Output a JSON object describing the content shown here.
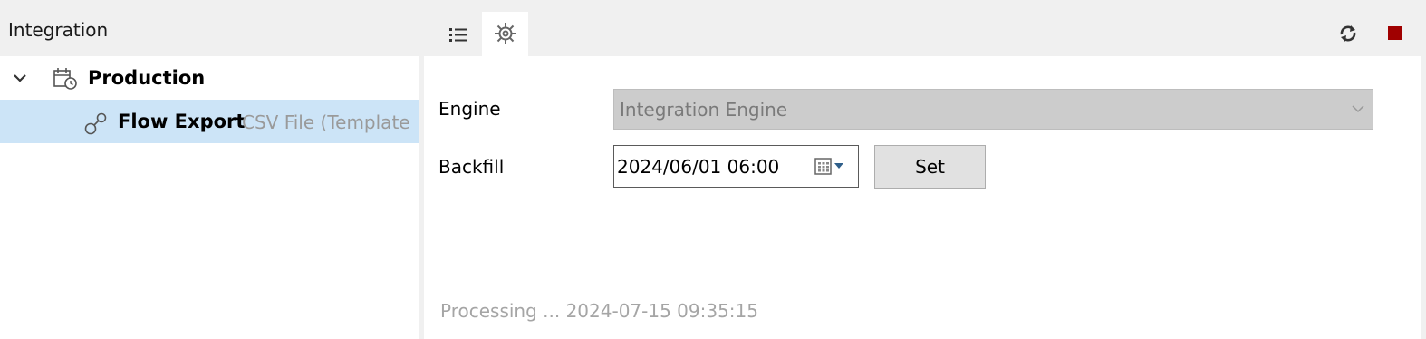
{
  "left_panel": {
    "title": "Integration",
    "tree": {
      "production": {
        "label": "Production",
        "expanded": true,
        "icon": "calendar-clock-icon"
      },
      "flow": {
        "label": "Flow Export",
        "sublabel": "CSV File (Template",
        "icon": "flow-node-icon",
        "selected": true
      }
    }
  },
  "right_panel": {
    "tabs": [
      {
        "name": "list",
        "icon": "list-icon",
        "active": false
      },
      {
        "name": "settings",
        "icon": "gear-icon",
        "active": true
      }
    ],
    "toolbar": {
      "refresh_icon": "refresh-icon",
      "stop_icon": "stop-icon"
    },
    "form": {
      "engine_label": "Engine",
      "engine_value": "Integration Engine",
      "backfill_label": "Backfill",
      "backfill_value": "2024/06/01 06:00",
      "set_label": "Set"
    },
    "status": "Processing ... 2024-07-15 09:35:15"
  },
  "colors": {
    "selection": "#cce4f7",
    "stop": "#a00000",
    "muted_text": "#9a9a9a",
    "header_bg": "#f0f0f0"
  }
}
